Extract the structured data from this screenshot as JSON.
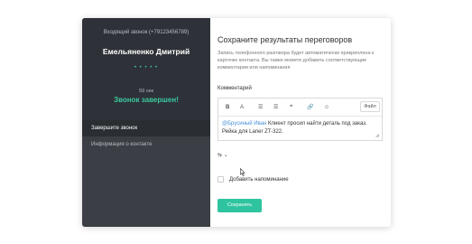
{
  "colors": {
    "accent": "#2fc4a0",
    "left_panel": "#3b3f45",
    "mention": "#4a90d9"
  },
  "left_panel": {
    "incoming_call": "Входящий звонок (+79123456789)",
    "caller_name": "Емельяненко Дмитрий",
    "dots": "• • • • •",
    "duration": "59 сек",
    "status": "Звонок завершен!",
    "nav": [
      {
        "label": "Завершите звонок"
      },
      {
        "label": "Информация о контакте"
      }
    ]
  },
  "right_panel": {
    "close_icon": "close-icon",
    "title": "Сохраните результаты переговоров",
    "subtitle": "Запись телефонного разговора будет автоматически прикреплена к карточке контакта. Вы также можете добавить соответствующие комментарии или напоминания",
    "comment_label": "Комментарий",
    "toolbar": {
      "bold": "B",
      "color": "A",
      "bullet_list": "☰",
      "numbered_list": "☰",
      "quote": "❝",
      "link": "🔗",
      "emoji": "☺",
      "file_label": "Файл"
    },
    "editor": {
      "mention": "@Брусиный Иван",
      "text": " Клиент просил найти деталь под заказ. Рейка для Laner ZT-322."
    },
    "dropdown_icon": "⇆ ⌄",
    "reminder_label": "Добавить напоминание",
    "save_label": "Сохранить"
  }
}
